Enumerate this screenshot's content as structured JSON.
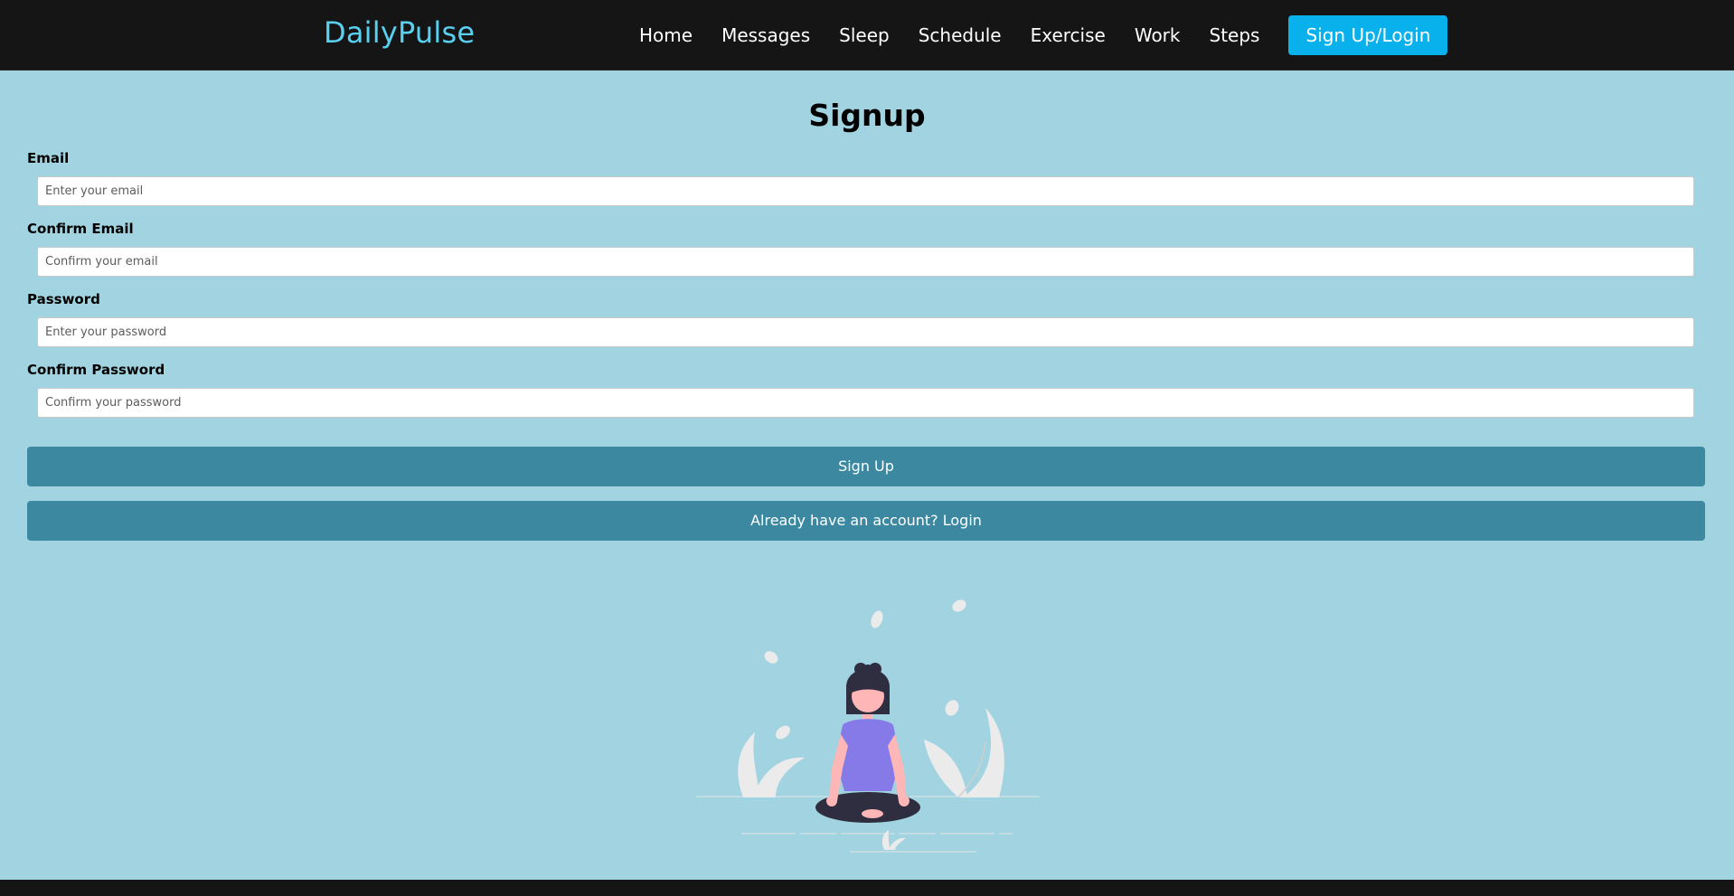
{
  "nav": {
    "brand": "DailyPulse",
    "links": [
      {
        "label": "Home"
      },
      {
        "label": "Messages"
      },
      {
        "label": "Sleep"
      },
      {
        "label": "Schedule"
      },
      {
        "label": "Exercise"
      },
      {
        "label": "Work"
      },
      {
        "label": "Steps"
      }
    ],
    "cta": "Sign Up/Login"
  },
  "form": {
    "title": "Signup",
    "fields": [
      {
        "label": "Email",
        "placeholder": "Enter your email",
        "value": ""
      },
      {
        "label": "Confirm Email",
        "placeholder": "Confirm your email",
        "value": ""
      },
      {
        "label": "Password",
        "placeholder": "Enter your password",
        "value": ""
      },
      {
        "label": "Confirm Password",
        "placeholder": "Confirm your password",
        "value": ""
      }
    ],
    "submit_label": "Sign Up",
    "login_label": "Already have an account? Login"
  },
  "colors": {
    "page_background": "#a1d3e1",
    "navbar_background": "#151515",
    "brand_color": "#5ad0f0",
    "cta_background": "#09b1ec",
    "button_background": "#3c88a1"
  },
  "icons": {
    "illustration": "meditation-illustration"
  }
}
